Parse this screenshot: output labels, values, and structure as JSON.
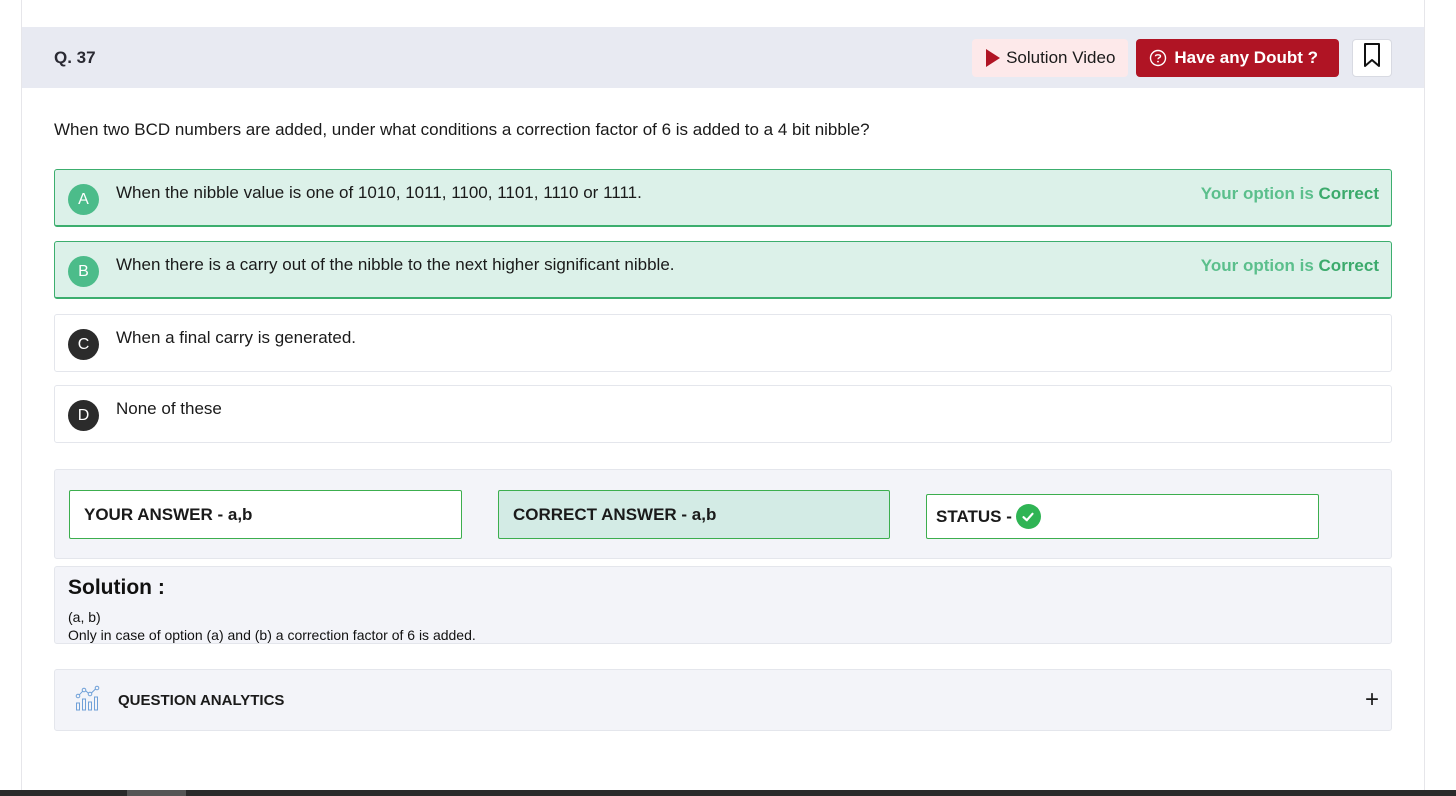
{
  "header": {
    "question_number": "Q. 37",
    "solution_video_label": "Solution Video",
    "doubt_label": "Have any Doubt ?"
  },
  "question": {
    "text": "When two BCD numbers are added, under what conditions a correction factor of 6 is added to a 4 bit nibble?"
  },
  "options": [
    {
      "letter": "A",
      "text": "When the nibble value is one of 1010, 1011, 1100, 1101, 1110 or 1111.",
      "status_prefix": "Your option is",
      "status_value": "Correct"
    },
    {
      "letter": "B",
      "text": "When there is a carry out of the nibble to the next higher significant nibble.",
      "status_prefix": "Your option is",
      "status_value": "Correct"
    },
    {
      "letter": "C",
      "text": "When a final carry is generated."
    },
    {
      "letter": "D",
      "text": "None of these"
    }
  ],
  "answers": {
    "your_answer": "YOUR ANSWER - a,b",
    "correct_answer": "CORRECT ANSWER - a,b",
    "status_label": "STATUS -"
  },
  "solution": {
    "title": "Solution :",
    "lines": [
      "(a, b)",
      "Only in case of option (a) and (b) a correction factor of 6 is added."
    ]
  },
  "analytics": {
    "label": "QUESTION ANALYTICS",
    "toggle": "+"
  },
  "colors": {
    "accent_red": "#b01424",
    "correct_green": "#3cae6e",
    "correct_bg": "#dcf1e9",
    "header_bg": "#e8eaf2"
  },
  "icons": [
    "play-icon",
    "doubt-icon",
    "bookmark-icon",
    "check-icon",
    "analytics-icon",
    "plus-icon"
  ]
}
